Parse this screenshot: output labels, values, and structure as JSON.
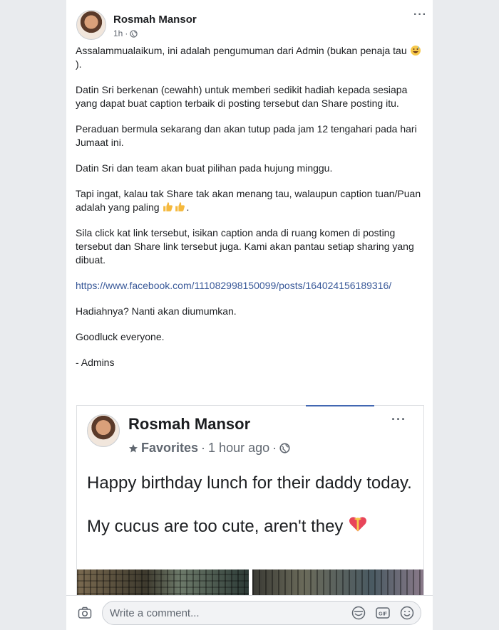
{
  "post": {
    "author": "Rosmah Mansor",
    "time": "1h",
    "privacy_icon": "globe-icon",
    "more_icon": "more-icon",
    "paragraphs": [
      "Assalammualaikum, ini adalah pengumuman dari Admin (bukan penaja tau ",
      "Datin Sri berkenan (cewahh) untuk memberi sedikit hadiah kepada sesiapa yang dapat buat caption terbaik di posting tersebut dan Share posting itu.",
      "Peraduan bermula sekarang dan akan tutup pada jam 12 tengahari pada hari Jumaat ini.",
      "Datin Sri dan team akan buat pilihan pada hujung minggu.",
      "Tapi ingat, kalau tak Share tak akan menang tau, walaupun caption tuan/Puan adalah yang paling ",
      "Sila click kat link tersebut, isikan caption anda di ruang komen di posting tersebut dan Share link tersebut juga. Kami akan pantau setiap sharing yang dibuat.",
      "Hadiahnya? Nanti akan diumumkan.",
      "Goodluck everyone.",
      "- Admins"
    ],
    "paragraph1_end": ").",
    "paragraph5_end": ".",
    "link": "https://www.facebook.com/111082998150099/posts/164024156189316/"
  },
  "shared_post": {
    "author": "Rosmah Mansor",
    "favorites": "Favorites",
    "time": "1 hour ago",
    "line1": "Happy birthday lunch for their daddy today.",
    "line2": "My cucus are too cute, aren't they "
  },
  "comment_bar": {
    "placeholder": "Write a comment..."
  }
}
